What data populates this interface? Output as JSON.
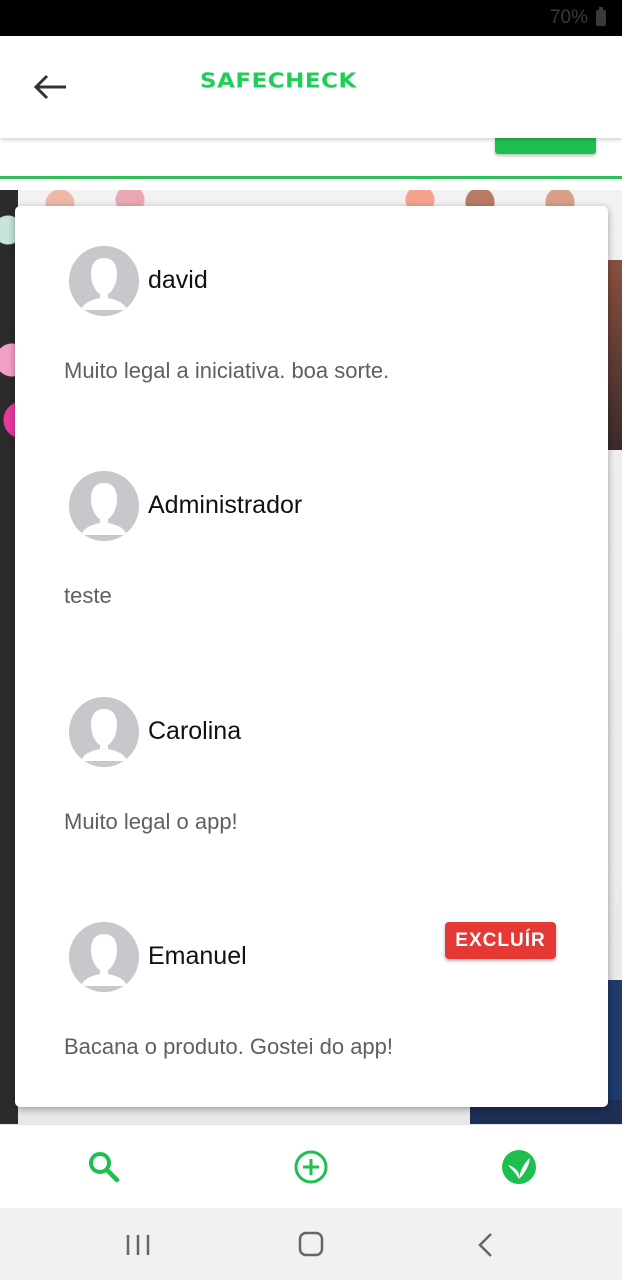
{
  "status_bar": {
    "battery": "70%"
  },
  "header": {
    "brand": "SAFECHECK",
    "back_icon": "arrow-left-icon"
  },
  "colors": {
    "accent": "#1fcf55",
    "danger": "#e53935",
    "avatar": "#c9c6cc"
  },
  "comments": [
    {
      "author": "david",
      "text": "Muito legal a iniciativa. boa sorte."
    },
    {
      "author": "Administrador",
      "text": "teste"
    },
    {
      "author": "Carolina",
      "text": "Muito legal o app!"
    },
    {
      "author": "Emanuel",
      "text": "Bacana o produto. Gostei do app!",
      "delete_label": "EXCLUÍR"
    }
  ],
  "bottom_nav": {
    "items": [
      {
        "icon": "search-icon"
      },
      {
        "icon": "add-circle-icon"
      },
      {
        "icon": "leaf-icon"
      }
    ]
  },
  "system_nav": {
    "items": [
      "recent-apps-icon",
      "home-icon",
      "back-icon"
    ]
  }
}
